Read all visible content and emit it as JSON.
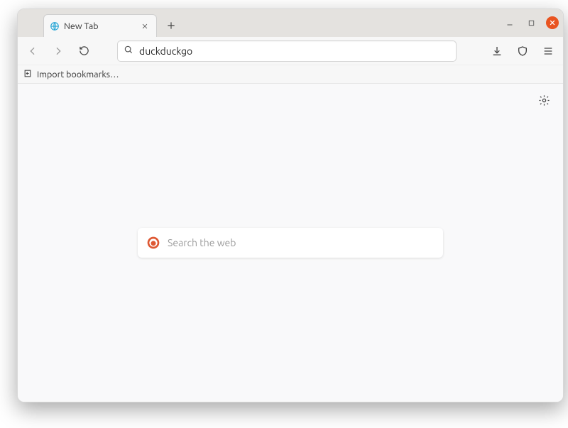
{
  "tab": {
    "title": "New Tab"
  },
  "urlbar": {
    "value": "duckduckgo"
  },
  "bookmarks": {
    "import_label": "Import bookmarks…"
  },
  "newtab_page": {
    "search_placeholder": "Search the web"
  }
}
